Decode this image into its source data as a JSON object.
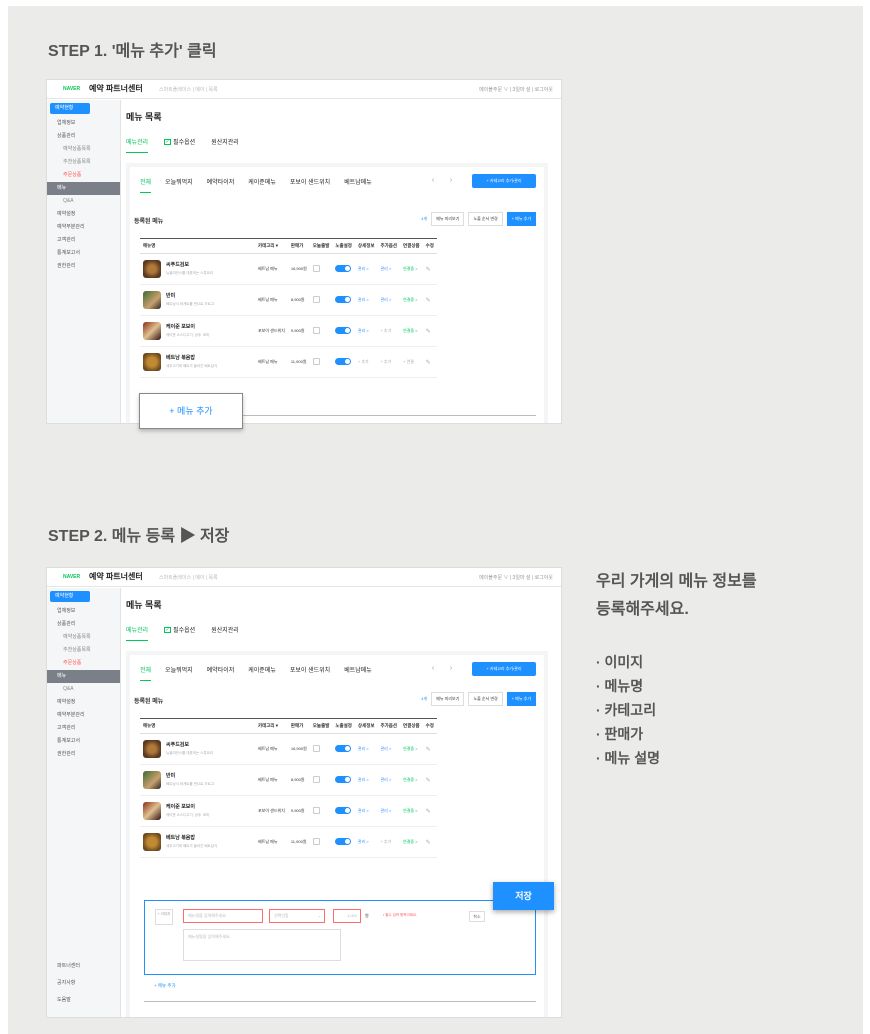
{
  "steps": [
    {
      "title": "STEP 1. '메뉴 추가' 클릭"
    },
    {
      "title": "STEP 2. 메뉴 등록 ▶ 저장"
    }
  ],
  "app": {
    "naver": "NAVER",
    "brand": "예약 파트너센터",
    "crumb": "스마트플레이스 | 메이 | 목록",
    "account": "메이볼주문 ∨ | 3일마 설 | 로그아웃"
  },
  "sidebar": {
    "items": [
      "예약현황",
      "업체정보",
      "상품관리",
      "예약상품목록",
      "추천상품목록",
      "주문상품",
      "메뉴",
      "Q&A",
      "예약설정",
      "예약부분관리",
      "고객관리",
      "통계보고서",
      "권한관리"
    ],
    "bottom": [
      "파트너센터",
      "공지사항",
      "도움말"
    ]
  },
  "page": {
    "title": "메뉴 목록",
    "tabs": [
      "메뉴관리",
      "필수옵션",
      "원산지관리"
    ]
  },
  "categories": [
    "전체",
    "오늘뭐먹지",
    "예약타이저",
    "케이준메뉴",
    "포보이 샌드위치",
    "베트남메뉴"
  ],
  "cat_add": "+ 카테고리 추가/관리",
  "registered": {
    "title": "등록된 메뉴",
    "count": "4개",
    "preview": "메뉴 미리보기",
    "order": "노출 순서 변경",
    "add": "+ 메뉴 추가"
  },
  "columns": [
    "메뉴명",
    "카테고리 ▾",
    "판매가",
    "오늘출발",
    "노출설정",
    "상세정보",
    "추가옵션",
    "연결상품",
    "수정"
  ],
  "menus": [
    {
      "name": "씨푸드검보",
      "desc": "뉴올리언스를 대표하는 스튜요리",
      "category": "베트남 메뉴",
      "price": "16,900원",
      "detail": "관리 >",
      "option": "관리 >",
      "link": "연결중 >"
    },
    {
      "name": "반미",
      "desc": "베트남식 바게트를 반으로 가르고",
      "category": "베트남 메뉴",
      "price": "8,900원",
      "detail": "관리 >",
      "option": "관리 >",
      "link": "연결중 >"
    },
    {
      "name": "케이준 포보이",
      "desc": "케이준 소스디고기, 상추, 토마",
      "category": "포보이 샌드위치",
      "price": "9,900원",
      "detail": "관리 >",
      "option": "+ 추가",
      "link": "연결중 >"
    },
    {
      "name": "베트남 볶음밥",
      "desc": "새우고기와 베트가 들어간 베트남식",
      "category": "베트남 메뉴",
      "price": "11,900원",
      "detail": "+ 추가",
      "option": "+ 추가",
      "link": "+ 연결"
    }
  ],
  "add_float": "+ 메뉴 추가",
  "form": {
    "img_label": "+ 이미지",
    "name_ph": "메뉴명을 입력해주세요.",
    "cat_ph": "선택안함",
    "price_ph": "1,000",
    "won": "원",
    "required": "• 필수 입력 항목이에요.",
    "cancel": "취소",
    "desc_ph": "메뉴설명을 입력해주세요.",
    "add_link": "+ 메뉴 추가"
  },
  "save": "저장",
  "info": {
    "headline1": "우리 가게의 메뉴 정보를",
    "headline2": "등록해주세요.",
    "fields": [
      "· 이미지",
      "· 메뉴명",
      "· 카테고리",
      "· 판매가",
      "· 메뉴 설명"
    ]
  }
}
